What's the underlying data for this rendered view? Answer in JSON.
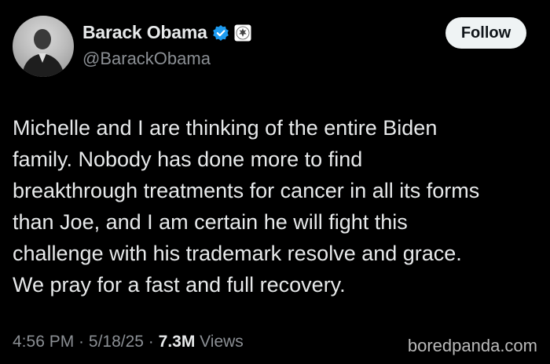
{
  "author": {
    "display_name": "Barack Obama",
    "handle": "@BarackObama",
    "verified_icon": "verified-badge-icon",
    "affiliation_icon": "government-seal-icon"
  },
  "actions": {
    "follow_label": "Follow"
  },
  "tweet": {
    "lines": [
      "Michelle and I are thinking of the entire Biden",
      "family. Nobody has done more to find",
      "breakthrough treatments for cancer in all its forms",
      "than Joe, and I am certain he will fight this",
      "challenge with his trademark resolve and grace.",
      "We pray for a fast and full recovery."
    ]
  },
  "meta": {
    "time": "4:56 PM",
    "date": "5/18/25",
    "separator": " · ",
    "views_count": "7.3M",
    "views_label": " Views"
  },
  "watermark": "boredpanda.com",
  "colors": {
    "background": "#000000",
    "text": "#e7e9ea",
    "secondary_text": "#8b8f94",
    "verified_blue": "#1d9bf0",
    "follow_bg": "#eff3f4"
  }
}
